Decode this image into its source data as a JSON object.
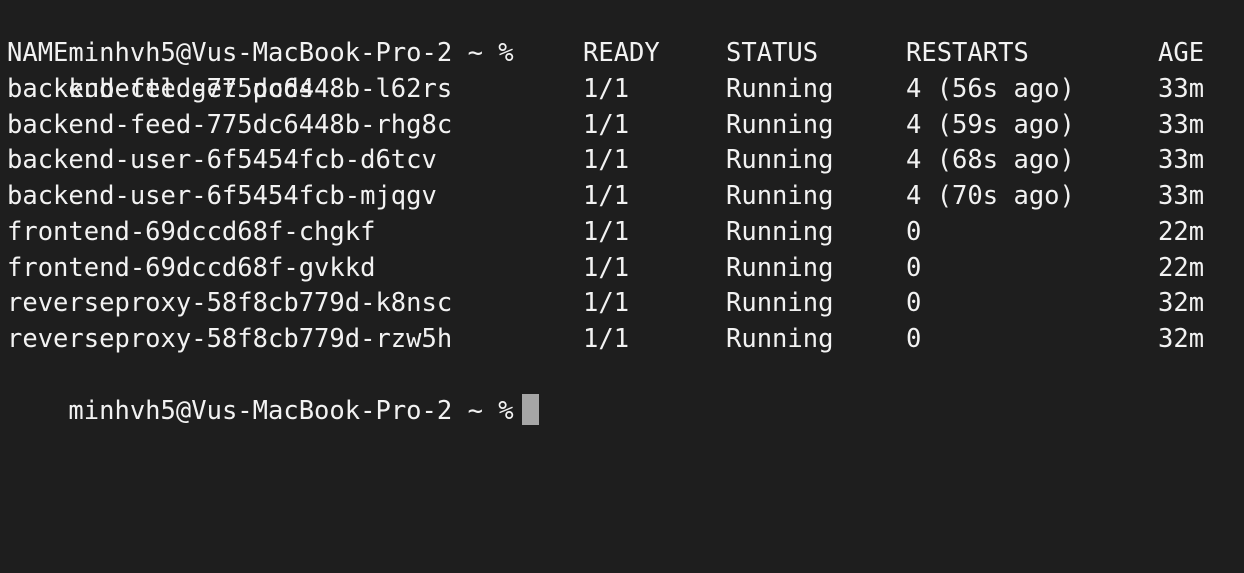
{
  "terminal": {
    "prompt_1": "minhvh5@Vus-MacBook-Pro-2 ~ %",
    "command": "kubectl get pods",
    "headers": {
      "name": "NAME",
      "ready": "READY",
      "status": "STATUS",
      "restarts": "RESTARTS",
      "age": "AGE"
    },
    "pods": [
      {
        "name": "backend-feed-775dc6448b-l62rs",
        "ready": "1/1",
        "status": "Running",
        "restarts": "4 (56s ago)",
        "age": "33m"
      },
      {
        "name": "backend-feed-775dc6448b-rhg8c",
        "ready": "1/1",
        "status": "Running",
        "restarts": "4 (59s ago)",
        "age": "33m"
      },
      {
        "name": "backend-user-6f5454fcb-d6tcv",
        "ready": "1/1",
        "status": "Running",
        "restarts": "4 (68s ago)",
        "age": "33m"
      },
      {
        "name": "backend-user-6f5454fcb-mjqgv",
        "ready": "1/1",
        "status": "Running",
        "restarts": "4 (70s ago)",
        "age": "33m"
      },
      {
        "name": "frontend-69dccd68f-chgkf",
        "ready": "1/1",
        "status": "Running",
        "restarts": "0",
        "age": "22m"
      },
      {
        "name": "frontend-69dccd68f-gvkkd",
        "ready": "1/1",
        "status": "Running",
        "restarts": "0",
        "age": "22m"
      },
      {
        "name": "reverseproxy-58f8cb779d-k8nsc",
        "ready": "1/1",
        "status": "Running",
        "restarts": "0",
        "age": "32m"
      },
      {
        "name": "reverseproxy-58f8cb779d-rzw5h",
        "ready": "1/1",
        "status": "Running",
        "restarts": "0",
        "age": "32m"
      }
    ],
    "prompt_2": "minhvh5@Vus-MacBook-Pro-2 ~ %"
  },
  "colors": {
    "background": "#1e1e1e",
    "foreground": "#f2f2f2",
    "cursor": "#a6a6a6"
  }
}
